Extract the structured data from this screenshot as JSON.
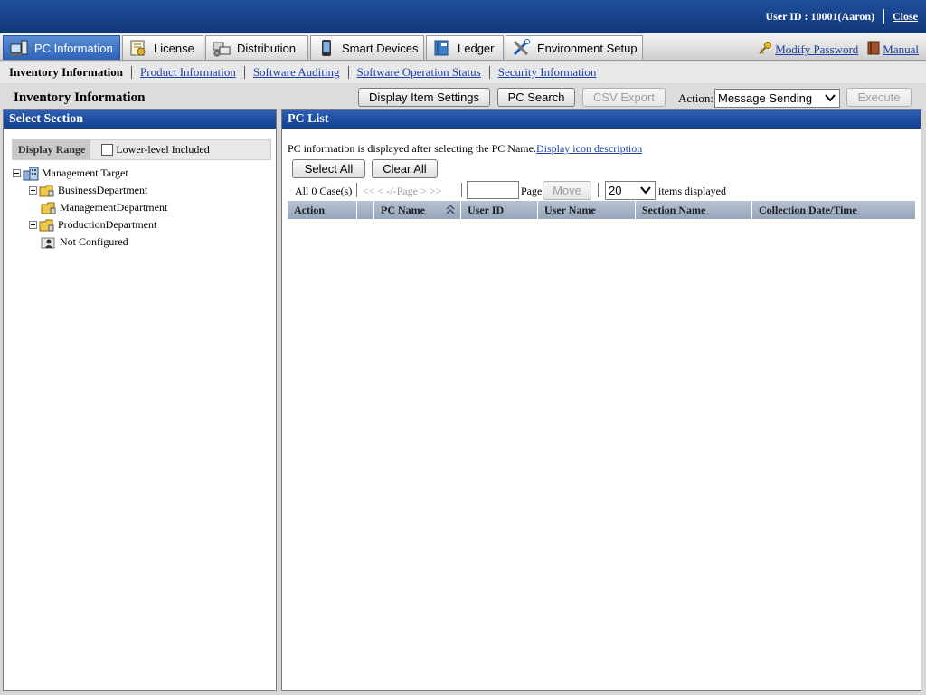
{
  "header": {
    "user_id_text": "User ID : 10001(Aaron)",
    "close_label": "Close"
  },
  "tabs": [
    {
      "label": "PC Information",
      "icon": "pc-icon",
      "active": true
    },
    {
      "label": "License",
      "icon": "license-icon",
      "active": false
    },
    {
      "label": "Distribution",
      "icon": "distribution-icon",
      "active": false
    },
    {
      "label": "Smart Devices",
      "icon": "smartphone-icon",
      "active": false
    },
    {
      "label": "Ledger",
      "icon": "ledger-icon",
      "active": false
    },
    {
      "label": "Environment Setup",
      "icon": "tools-icon",
      "active": false
    }
  ],
  "top_links": {
    "modify_password": "Modify Password",
    "manual": "Manual"
  },
  "subnav": {
    "current": "Inventory Information",
    "links": [
      "Product Information",
      "Software Auditing",
      "Software Operation Status",
      "Security Information"
    ]
  },
  "toolbar": {
    "page_title": "Inventory Information",
    "display_item_settings": "Display Item Settings",
    "pc_search": "PC Search",
    "csv_export": "CSV Export",
    "action_label": "Action:",
    "action_value": "Message Sending",
    "execute": "Execute"
  },
  "left_panel": {
    "title": "Select Section",
    "display_range_label": "Display Range",
    "lower_level_label": "Lower-level Included",
    "tree": [
      {
        "label": "Management Target",
        "level": 0,
        "expander": "minus",
        "icon": "building-icon"
      },
      {
        "label": "BusinessDepartment",
        "level": 1,
        "expander": "plus",
        "icon": "folder-icon"
      },
      {
        "label": "ManagementDepartment",
        "level": 1,
        "expander": "none",
        "icon": "folder-icon"
      },
      {
        "label": "ProductionDepartment",
        "level": 1,
        "expander": "plus",
        "icon": "folder-icon"
      },
      {
        "label": "Not Configured",
        "level": 1,
        "expander": "none",
        "icon": "user-folder-icon"
      }
    ]
  },
  "right_panel": {
    "title": "PC List",
    "info_text": "PC information is displayed after selecting the PC Name.",
    "info_link": "Display icon description",
    "select_all": "Select All",
    "clear_all": "Clear All",
    "pager": {
      "count_text": "All 0 Case(s)",
      "nav_text": "<< < -/-Page > >>",
      "page_label": "Page",
      "move": "Move",
      "per_page": "20",
      "items_label": "items displayed"
    },
    "columns": [
      "Action",
      "",
      "PC Name",
      "User ID",
      "User Name",
      "Section Name",
      "Collection Date/Time"
    ]
  }
}
